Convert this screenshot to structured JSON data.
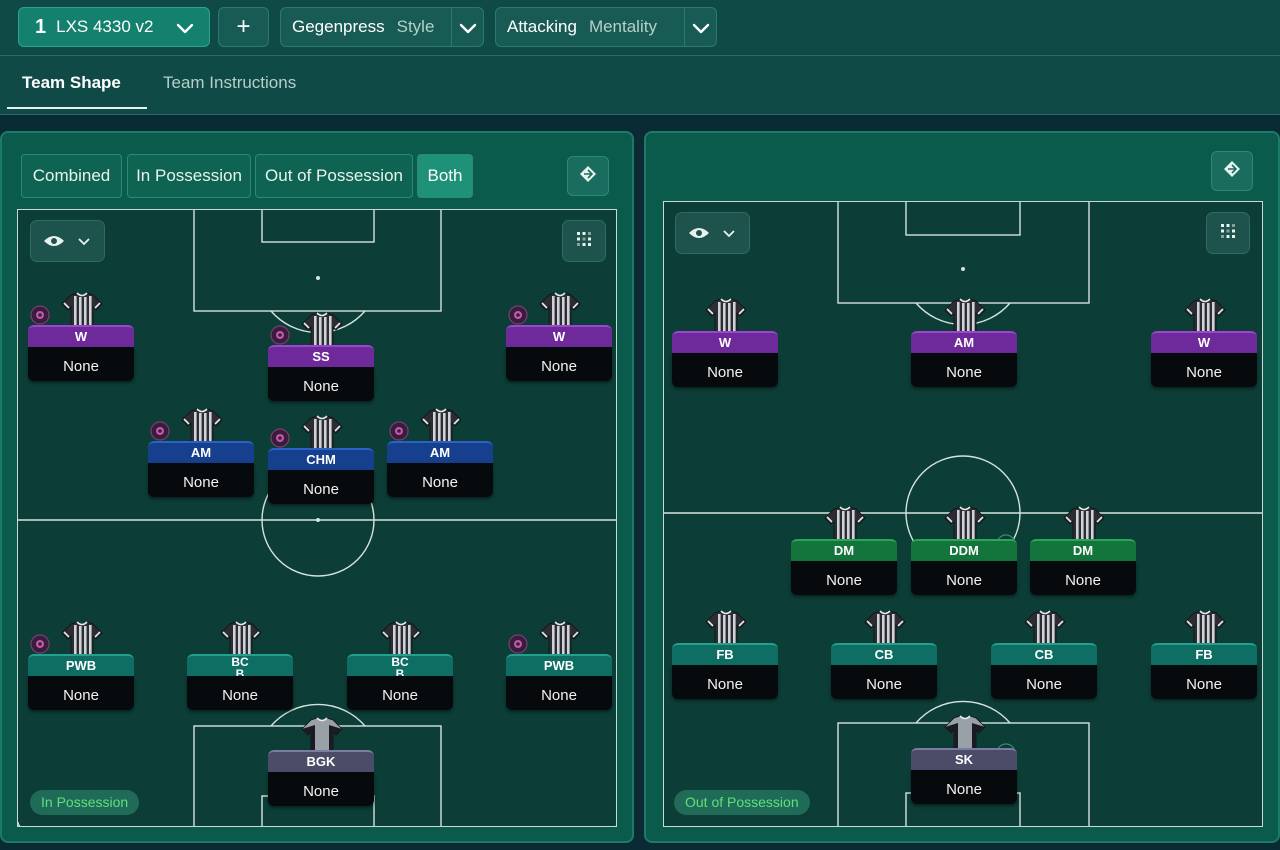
{
  "top": {
    "tactic_number": "1",
    "tactic_name": "LXS 4330 v2",
    "add_label": "+",
    "style_value": "Gegenpress",
    "style_key": "Style",
    "mentality_value": "Attacking",
    "mentality_key": "Mentality"
  },
  "tabs": [
    {
      "label": "Team Shape",
      "active": true
    },
    {
      "label": "Team Instructions",
      "active": false
    }
  ],
  "view_modes": [
    {
      "label": "Combined",
      "active": false
    },
    {
      "label": "In Possession",
      "active": false
    },
    {
      "label": "Out of Possession",
      "active": false
    },
    {
      "label": "Both",
      "active": true
    }
  ],
  "left_pitch": {
    "phase_label": "In Possession",
    "players": [
      {
        "role": "W",
        "duty": "None",
        "color": "purple"
      },
      {
        "role": "SS",
        "duty": "None",
        "color": "purple"
      },
      {
        "role": "W",
        "duty": "None",
        "color": "purple"
      },
      {
        "role": "AM",
        "duty": "None",
        "color": "blue"
      },
      {
        "role": "CHM",
        "duty": "None",
        "color": "blue"
      },
      {
        "role": "AM",
        "duty": "None",
        "color": "blue"
      },
      {
        "role": "PWB",
        "duty": "None",
        "color": "teal"
      },
      {
        "role": "BC\nB",
        "duty": "None",
        "color": "teal"
      },
      {
        "role": "BC\nB",
        "duty": "None",
        "color": "teal"
      },
      {
        "role": "PWB",
        "duty": "None",
        "color": "teal"
      },
      {
        "role": "BGK",
        "duty": "None",
        "color": "grey"
      }
    ]
  },
  "right_pitch": {
    "phase_label": "Out of Possession",
    "players": [
      {
        "role": "W",
        "duty": "None",
        "color": "purple"
      },
      {
        "role": "AM",
        "duty": "None",
        "color": "purple"
      },
      {
        "role": "W",
        "duty": "None",
        "color": "purple"
      },
      {
        "role": "DM",
        "duty": "None",
        "color": "green"
      },
      {
        "role": "DDM",
        "duty": "None",
        "color": "green"
      },
      {
        "role": "DM",
        "duty": "None",
        "color": "green"
      },
      {
        "role": "FB",
        "duty": "None",
        "color": "teal"
      },
      {
        "role": "CB",
        "duty": "None",
        "color": "teal"
      },
      {
        "role": "CB",
        "duty": "None",
        "color": "teal"
      },
      {
        "role": "FB",
        "duty": "None",
        "color": "teal"
      },
      {
        "role": "SK",
        "duty": "None",
        "color": "grey"
      }
    ]
  },
  "icons": {
    "tactic_dropdown": "chevron-down-icon",
    "view_toggle": "eye-icon",
    "grid_toggle": "grid-icon",
    "swap": "swap-icon",
    "ip_badge": "in-possession-badge-icon",
    "oop_badge": "out-of-possession-badge-icon"
  },
  "colors": {
    "accent": "#14806e",
    "pitch": "#0c3d37",
    "panel": "#0b5b4d",
    "role_purple": "#6e2a9a",
    "role_blue": "#163f8e",
    "role_teal": "#0e6e63",
    "role_green": "#13743c",
    "role_grey": "#4b4c68",
    "phase_label": "#5fe07c"
  }
}
